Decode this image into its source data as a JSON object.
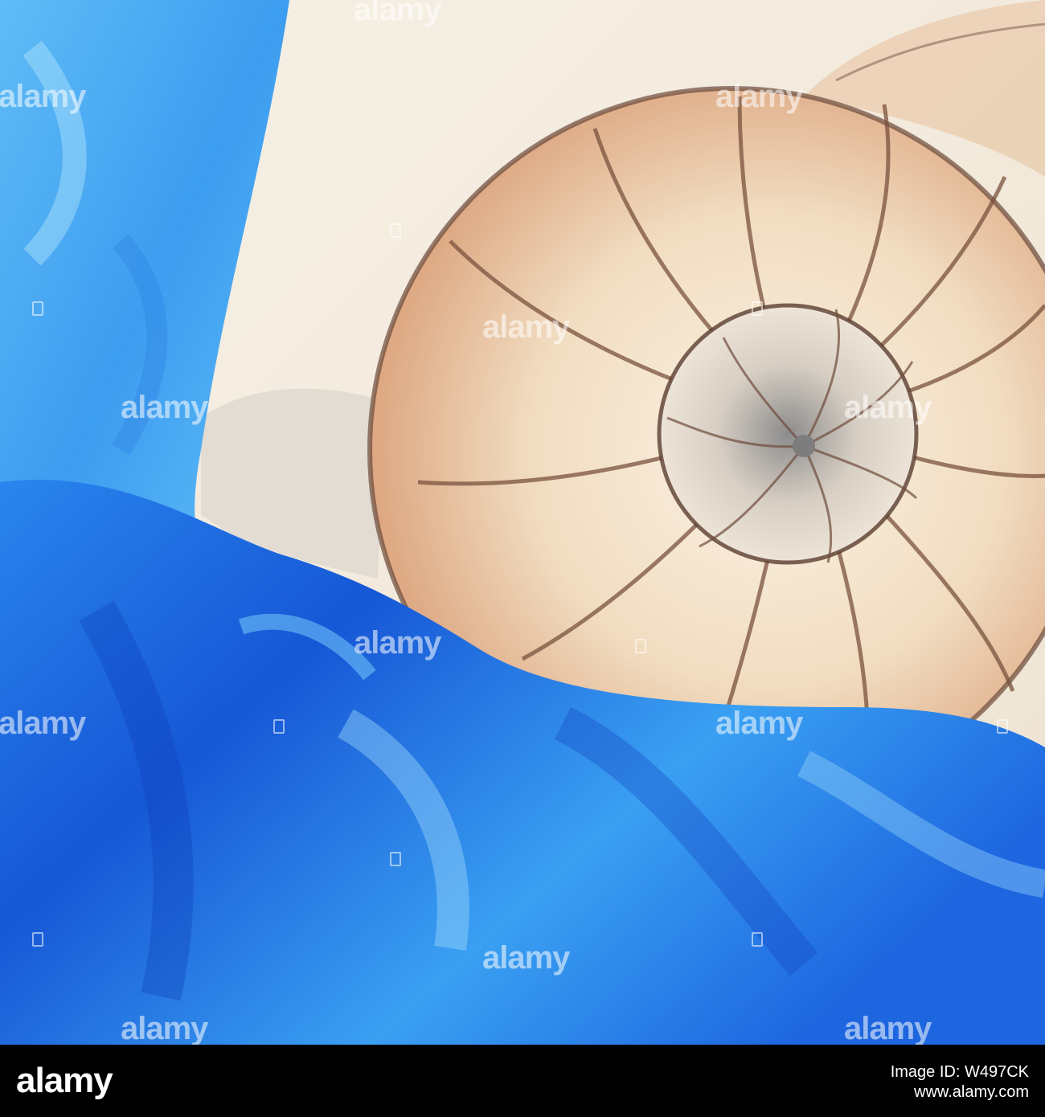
{
  "watermark": {
    "text": "alamy"
  },
  "footer": {
    "logo": "alamy",
    "image_id": "Image ID: W497CK",
    "url": "www.alamy.com"
  },
  "palette": {
    "satin_blue": "#1f6fe8",
    "satin_light": "#4fb0f5",
    "shell_cream": "#f3e7d3",
    "shell_rust": "#c9825a",
    "shell_line": "#6b4a3a",
    "background_cream": "#f3ece0"
  }
}
